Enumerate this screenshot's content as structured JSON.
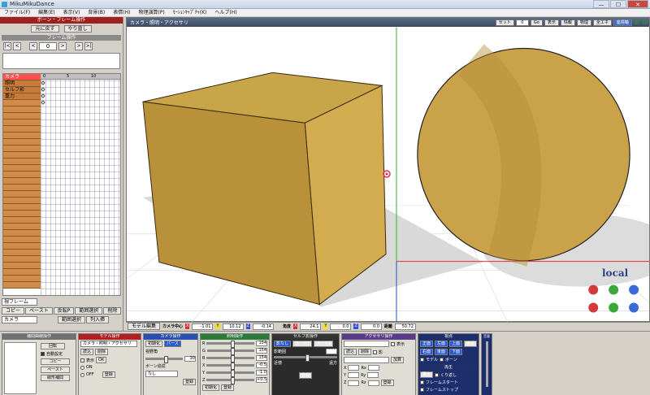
{
  "window": {
    "title": "MikuMikuDance"
  },
  "menu": [
    "ファイル(F)",
    "編集(E)",
    "表示(V)",
    "背景(B)",
    "表情(H)",
    "物理演算(P)",
    "ﾓｰｼｮﾝｷｬﾌﾟﾁｬ(K)",
    "ヘルプ(H)"
  ],
  "left": {
    "bone_frame_header": "ボーン・フレーム操作",
    "undo": "元に戻す",
    "redo": "やり直し",
    "frame_op": "フレーム操作",
    "frame_value": "0",
    "nav": {
      "first": "|<",
      "prev_key": "<",
      "prev": "<",
      "next": ">",
      "next_key": ">",
      "last": ">|"
    },
    "timeline_marks": [
      "0",
      "5",
      "10"
    ],
    "rows": [
      "カメラ",
      "照明",
      "セルフ影",
      "重力"
    ],
    "view_frame": "視フレーム",
    "copy": "コピー",
    "paste": "ペースト",
    "reverse": "反転P",
    "range_select": "範囲選択",
    "delete": "削除",
    "camera_select": "カメラ",
    "range_extend": "範囲選択",
    "frame_insert": "列入挿"
  },
  "viewport": {
    "title": "カメラ・照明・アクセサリ",
    "frame_label": "セット",
    "frame_val": "0",
    "go": "Go",
    "tools": [
      "表示",
      "情報",
      "物理",
      "全エネ",
      "座標軸"
    ],
    "local": "local"
  },
  "status": {
    "model_label": "モデル編集",
    "camera_center": "カメラ中心",
    "cx": "-1.01",
    "cy": "10.12",
    "cz": "-0.14",
    "angle": "角度",
    "ax": "24.1",
    "ay": "0.0",
    "az": "0.0",
    "distance": "距離",
    "dist_val": "50.72"
  },
  "bottom": {
    "interp": {
      "title": "補間曲線操作",
      "rot": "回転",
      "auto": "自動設定",
      "copy": "コピー",
      "paste": "ペースト",
      "linear": "線形補間"
    },
    "model": {
      "title": "モデル操作",
      "select": "カメラ・照明・アクセサリ",
      "load": "読込",
      "delete": "削除",
      "show": "表示",
      "info": "OK",
      "on": "ON",
      "off": "OFF",
      "reg": "登録"
    },
    "camera": {
      "title": "カメラ操作",
      "init": "初期化",
      "perspective": "パース",
      "view_angle": "視野角",
      "view_val": "30",
      "bone_follow": "ボーン追従",
      "none": "なし",
      "reg": "登録"
    },
    "light": {
      "title": "照明操作",
      "r": "154",
      "g": "154",
      "b": "154",
      "x": "-0.5",
      "y": "-1.0",
      "z": "+0.5",
      "init": "初期化",
      "reg": "登録"
    },
    "shadow": {
      "title": "セルフ影操作",
      "none": "影なし",
      "mode1": "モード1",
      "mode2": "モード2",
      "range": "影範囲",
      "range_val": "8875",
      "near": "近傍",
      "far": "遠方",
      "reg": "登録"
    },
    "accessory": {
      "title": "アクセサリ操作",
      "load": "読込",
      "delete": "削除",
      "show": "表示",
      "shadow": "影",
      "add": "加算",
      "reg": "登録"
    },
    "view": {
      "title": "視点",
      "front": "正面",
      "left": "左面",
      "top": "上面",
      "track": "追従",
      "right": "右面",
      "back": "後面",
      "bottom": "下面",
      "model": "モデル",
      "bone": "ボーン"
    },
    "play": {
      "title": "再生",
      "play": "再生",
      "repeat": "くり返し",
      "start": "フレームスタート",
      "stop": "フレームストップ",
      "volume": "音量"
    }
  }
}
